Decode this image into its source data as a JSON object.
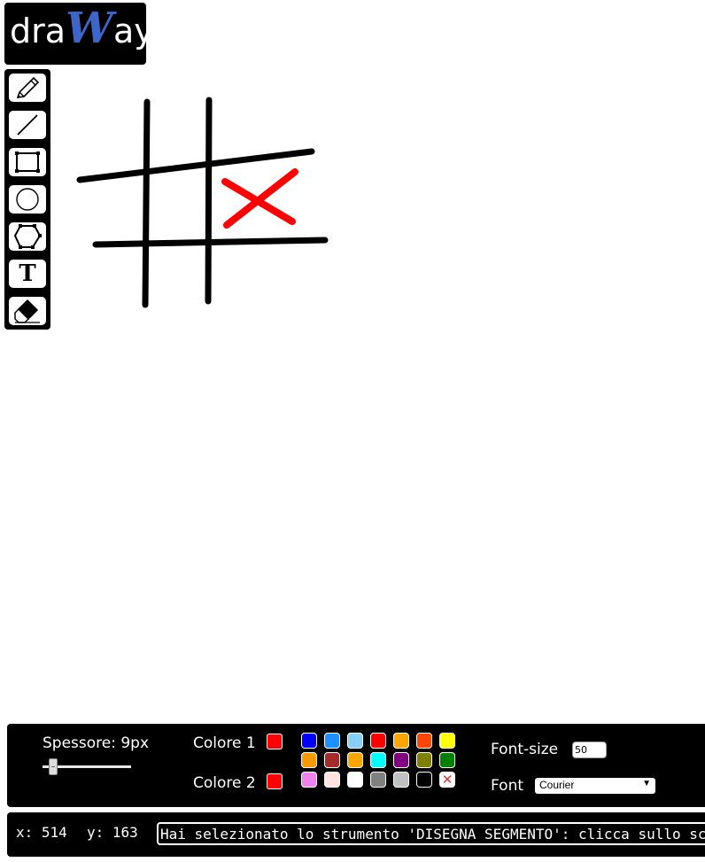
{
  "logo": {
    "prefix": "dra",
    "big": "W",
    "suffix": "ay"
  },
  "tools": [
    {
      "name": "pencil-tool",
      "icon": "pencil-icon"
    },
    {
      "name": "line-tool",
      "icon": "line-icon"
    },
    {
      "name": "rectangle-tool",
      "icon": "rectangle-icon"
    },
    {
      "name": "circle-tool",
      "icon": "circle-icon"
    },
    {
      "name": "polygon-tool",
      "icon": "polygon-icon"
    },
    {
      "name": "text-tool",
      "icon": "text-icon",
      "glyph": "T"
    },
    {
      "name": "eraser-tool",
      "icon": "eraser-icon"
    }
  ],
  "controls": {
    "thickness_label": "Spessore: 9px",
    "thickness_value": 9,
    "color1_label": "Colore 1",
    "color2_label": "Colore 2",
    "color1": "#ff0000",
    "color2": "#ff0000",
    "palette_row1": [
      "#0000ff",
      "#1e90ff",
      "#87cefa",
      "#ff0000",
      "#ffa500",
      "#ff4500",
      "#ffff00"
    ],
    "palette_row2": [
      "#ff9900",
      "#a52a2a",
      "#ffa500",
      "#00ffff",
      "#800080",
      "#808000",
      "#008000"
    ],
    "palette_row3": [
      "#ee82ee",
      "#ffe4e1",
      "#ffffff",
      "#808080",
      "#c0c0c0",
      "#000000",
      "transparent"
    ],
    "fontsize_label": "Font-size",
    "fontsize_value": "50",
    "font_label": "Font",
    "font_value": "Courier"
  },
  "status": {
    "x_label": "x: 514",
    "y_label": "y: 163",
    "message": "Hai selezionato lo strumento 'DISEGNA SEGMENTO': clicca sullo schermo"
  }
}
